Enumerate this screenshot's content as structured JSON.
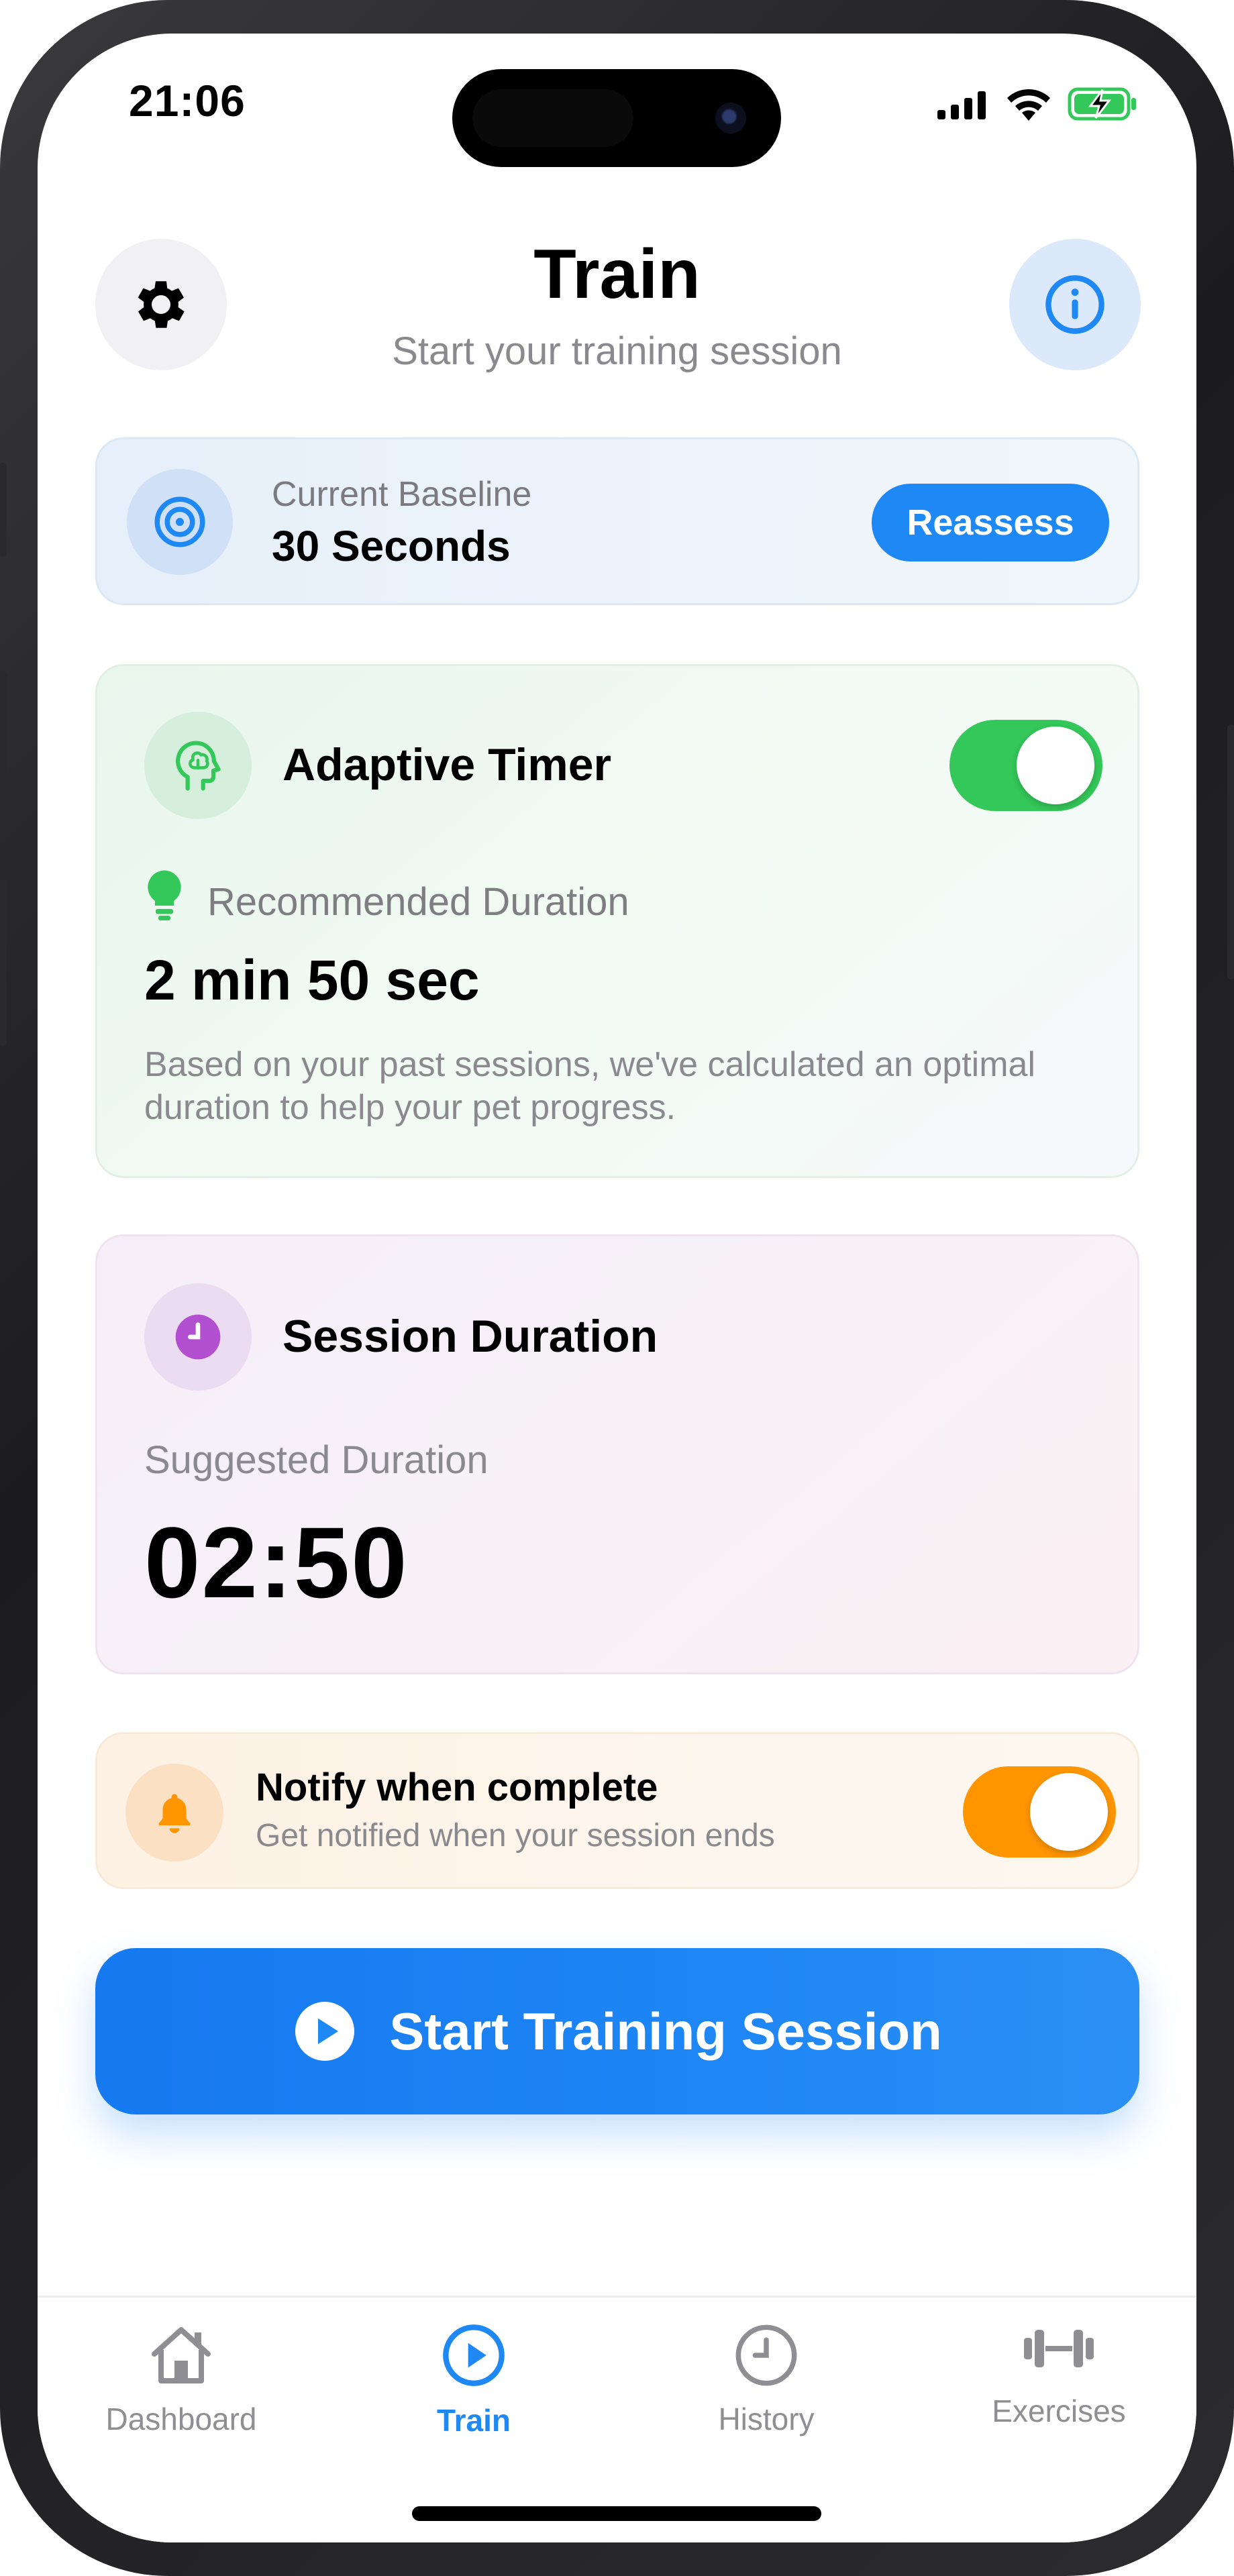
{
  "status_bar": {
    "time": "21:06",
    "icons": [
      "cellular-signal-icon",
      "wifi-icon",
      "battery-charging-icon"
    ],
    "battery_color": "#34c759"
  },
  "header": {
    "title": "Train",
    "subtitle": "Start your training session",
    "left_icon": "gear-icon",
    "right_icon": "info-icon"
  },
  "baseline": {
    "icon": "target-icon",
    "label": "Current Baseline",
    "value": "30 Seconds",
    "button_label": "Reassess"
  },
  "adaptive_timer": {
    "icon": "brain-head-icon",
    "title": "Adaptive Timer",
    "enabled": true,
    "recommended_icon": "lightbulb-icon",
    "recommended_label": "Recommended Duration",
    "recommended_value": "2 min 50 sec",
    "description": "Based on your past sessions, we've calculated an optimal duration to help your pet progress."
  },
  "session_duration": {
    "icon": "clock-icon",
    "title": "Session Duration",
    "suggested_label": "Suggested Duration",
    "suggested_value": "02:50"
  },
  "notify": {
    "icon": "bell-icon",
    "title": "Notify when complete",
    "subtitle": "Get notified when your session ends",
    "enabled": true
  },
  "start_button": {
    "icon": "play-circle-icon",
    "label": "Start Training Session"
  },
  "tabs": [
    {
      "label": "Dashboard",
      "icon": "house-icon",
      "active": false
    },
    {
      "label": "Train",
      "icon": "play-circle-icon",
      "active": true
    },
    {
      "label": "History",
      "icon": "clock-icon",
      "active": false
    },
    {
      "label": "Exercises",
      "icon": "dumbbell-icon",
      "active": false
    }
  ],
  "colors": {
    "accent": "#1e88f5",
    "green": "#34c759",
    "orange": "#ff9500",
    "purple": "#b14fd0"
  }
}
